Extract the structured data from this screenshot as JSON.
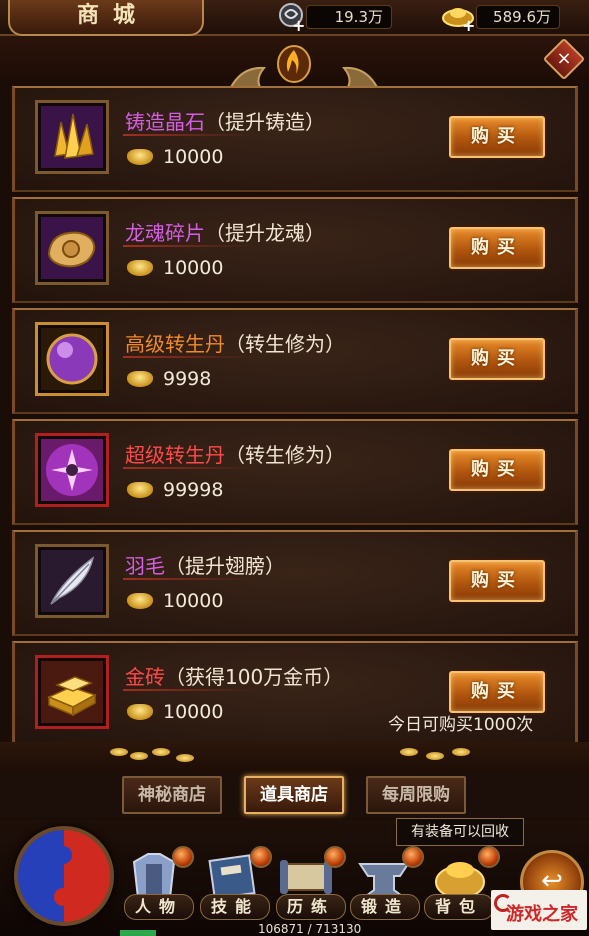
{
  "header": {
    "title": "商城",
    "currency1": "19.3万",
    "currency2": "589.6万",
    "plus": "+"
  },
  "close_label": "×",
  "items": [
    {
      "name": "铸造晶石",
      "note": "（提升铸造）",
      "price": "10000",
      "buy": "购买",
      "name_color": "purple"
    },
    {
      "name": "龙魂碎片",
      "note": "（提升龙魂）",
      "price": "10000",
      "buy": "购买",
      "name_color": "purple"
    },
    {
      "name": "高级转生丹",
      "note": "（转生修为）",
      "price": "9998",
      "buy": "购买",
      "name_color": "orange"
    },
    {
      "name": "超级转生丹",
      "note": "（转生修为）",
      "price": "99998",
      "buy": "购买",
      "name_color": "red"
    },
    {
      "name": "羽毛",
      "note": "（提升翅膀）",
      "price": "10000",
      "buy": "购买",
      "name_color": "purple"
    },
    {
      "name": "金砖",
      "note": "（获得100万金币）",
      "price": "10000",
      "buy": "购买",
      "name_color": "red"
    }
  ],
  "daily_limit": "今日可购买1000次",
  "tabs": [
    {
      "label": "神秘商店",
      "active": false
    },
    {
      "label": "道具商店",
      "active": true
    },
    {
      "label": "每周限购",
      "active": false
    }
  ],
  "tooltip": "有装备可以回收",
  "nav": [
    {
      "label": "人物",
      "icon": "armor-icon"
    },
    {
      "label": "技能",
      "icon": "skill-book-icon"
    },
    {
      "label": "历练",
      "icon": "scroll-icon"
    },
    {
      "label": "锻造",
      "icon": "anvil-icon"
    },
    {
      "label": "背包",
      "icon": "gold-bag-icon"
    }
  ],
  "exp": "106871 / 713130",
  "watermark": "游戏之家",
  "colors": {
    "accent": "#e88a2a",
    "purple_name": "#d45ee4",
    "orange_name": "#f08a2a",
    "red_name": "#ff4a4a"
  }
}
